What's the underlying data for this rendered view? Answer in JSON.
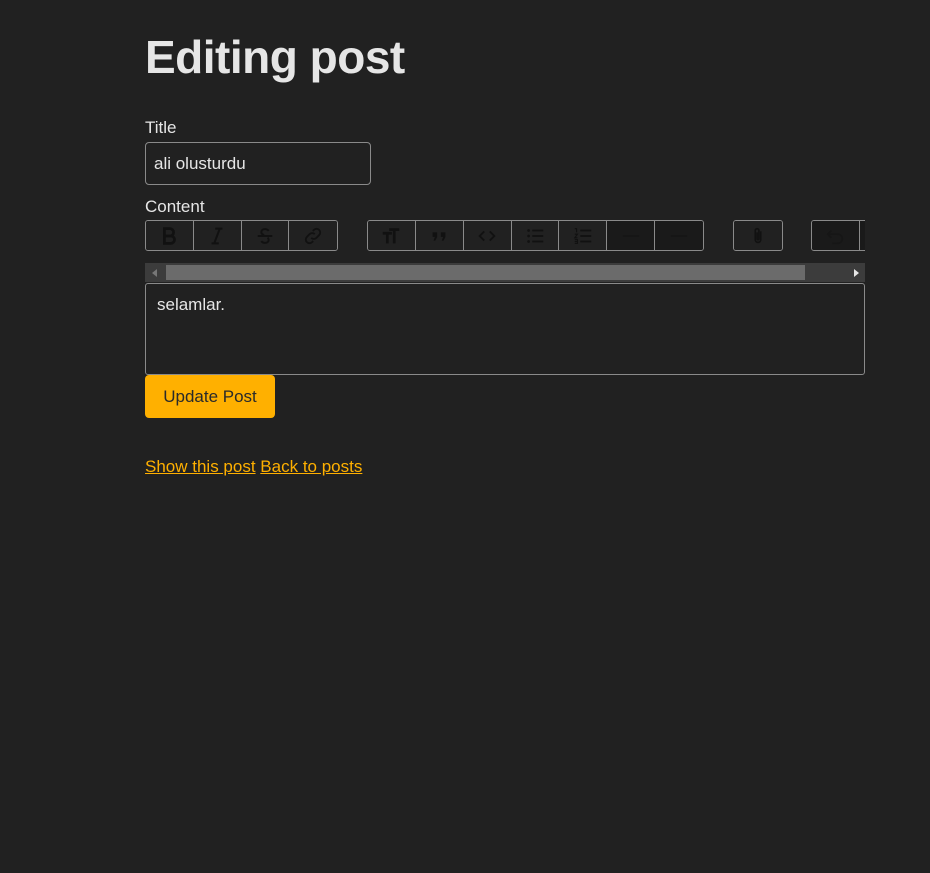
{
  "page": {
    "heading": "Editing post"
  },
  "form": {
    "title_label": "Title",
    "title_value": "ali olusturdu",
    "content_label": "Content",
    "content_text": "selamlar.",
    "submit_label": "Update Post"
  },
  "toolbar": {
    "text_tools": [
      {
        "name": "bold-button",
        "icon": "bold-icon"
      },
      {
        "name": "italic-button",
        "icon": "italic-icon"
      },
      {
        "name": "strike-button",
        "icon": "strike-icon"
      },
      {
        "name": "link-button",
        "icon": "link-icon"
      }
    ],
    "block_tools": [
      {
        "name": "heading-button",
        "icon": "heading-icon"
      },
      {
        "name": "quote-button",
        "icon": "quote-icon"
      },
      {
        "name": "code-button",
        "icon": "code-icon"
      },
      {
        "name": "bullet-list-button",
        "icon": "bullet-list-icon"
      },
      {
        "name": "number-list-button",
        "icon": "number-list-icon"
      },
      {
        "name": "decrease-indent-button",
        "icon": "decrease-indent-icon"
      },
      {
        "name": "increase-indent-button",
        "icon": "increase-indent-icon"
      }
    ],
    "file_tools": [
      {
        "name": "attach-file-button",
        "icon": "paperclip-icon"
      }
    ],
    "history_tools": [
      {
        "name": "undo-button",
        "icon": "undo-icon"
      },
      {
        "name": "redo-button",
        "icon": "redo-icon"
      }
    ]
  },
  "links": {
    "show": "Show this post",
    "back": "Back to posts"
  },
  "colors": {
    "background": "#212121",
    "accent": "#ffb000",
    "text": "#e6e6e6",
    "border": "#8a8a8a"
  }
}
